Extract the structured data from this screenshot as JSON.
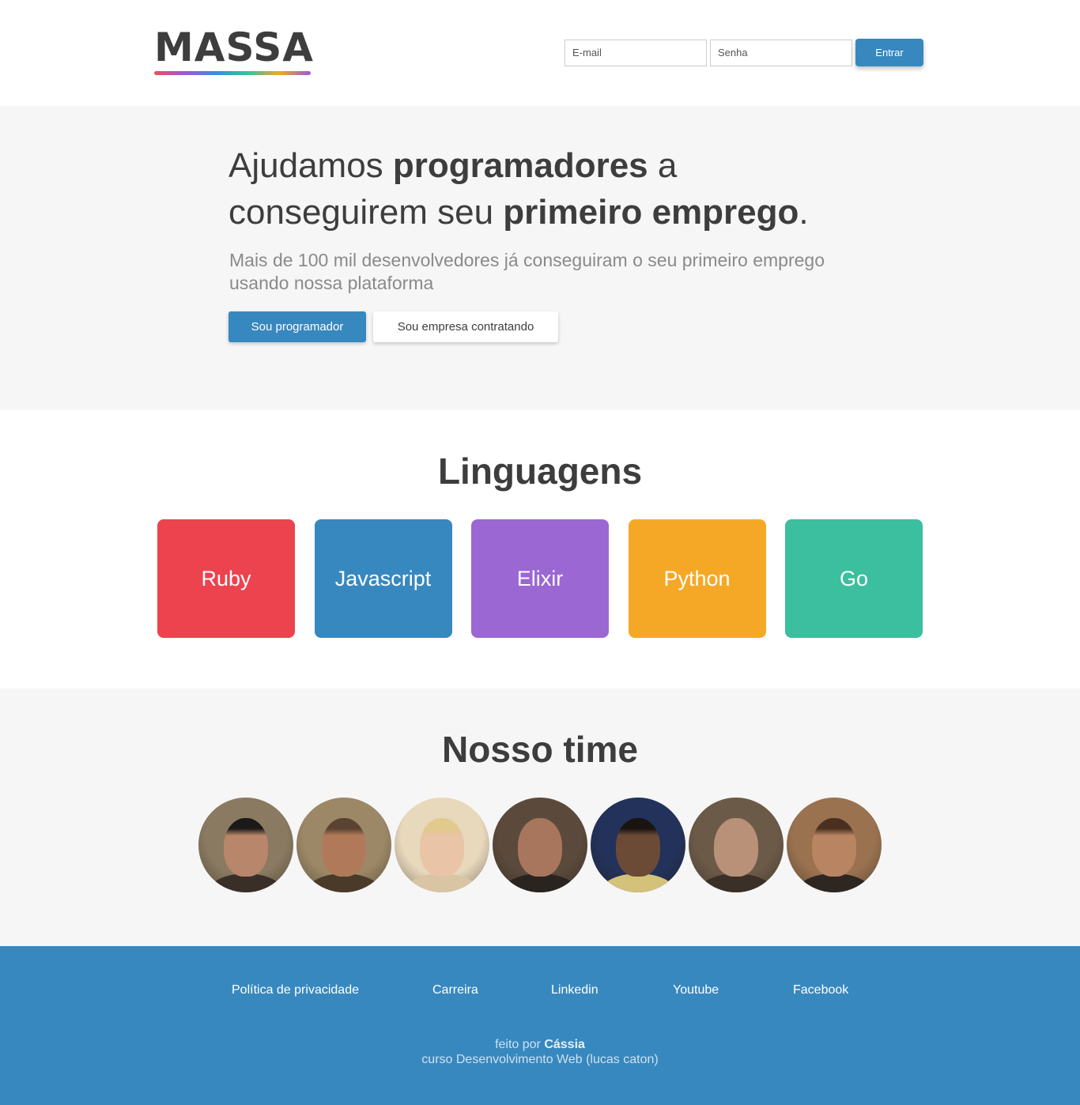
{
  "brand": {
    "logo": "MASSA",
    "logo_gradient": [
      "#ec4f5e",
      "#9b59d6",
      "#3a8fd9",
      "#3cc09f",
      "#f5a623",
      "#9b59d6"
    ]
  },
  "login": {
    "email_placeholder": "E-mail",
    "password_placeholder": "Senha",
    "submit_label": "Entrar"
  },
  "hero": {
    "title_parts": [
      "Ajudamos ",
      "programadores",
      " a conseguirem seu ",
      "primeiro emprego",
      "."
    ],
    "subtitle": "Mais de 100 mil desenvolvedores já conseguiram o seu primeiro emprego usando nossa plataforma",
    "primary_button": "Sou programador",
    "secondary_button": "Sou empresa contratando"
  },
  "languages": {
    "title": "Linguagens",
    "items": [
      {
        "label": "Ruby",
        "color": "#ec434e"
      },
      {
        "label": "Javascript",
        "color": "#3788bf"
      },
      {
        "label": "Elixir",
        "color": "#9b67d3"
      },
      {
        "label": "Python",
        "color": "#f5a826"
      },
      {
        "label": "Go",
        "color": "#3bbf9e"
      }
    ]
  },
  "team": {
    "title": "Nosso time",
    "members": [
      {
        "avatar_bg": "#8a7a62",
        "skin": "#b8866a",
        "cloth": "#3a2f28",
        "hair": "#1c1a18"
      },
      {
        "avatar_bg": "#9c8866",
        "skin": "#b07a5a",
        "cloth": "#4a3a2a",
        "hair": "#5a4330"
      },
      {
        "avatar_bg": "#e8d8bc",
        "skin": "#e9c4a6",
        "cloth": "#d9c4a4",
        "hair": "#e2c98c"
      },
      {
        "avatar_bg": "#5b4a3c",
        "skin": "#a7765c",
        "cloth": "#2a2420",
        "hair": "#a7765c"
      },
      {
        "avatar_bg": "#23325a",
        "skin": "#6b4a36",
        "cloth": "#d4c27a",
        "hair": "#1a1410"
      },
      {
        "avatar_bg": "#6c5a48",
        "skin": "#b99078",
        "cloth": "#3a3028",
        "hair": "#b99078"
      },
      {
        "avatar_bg": "#9a7250",
        "skin": "#b88462",
        "cloth": "#2e2620",
        "hair": "#4a3020"
      }
    ]
  },
  "footer": {
    "links": [
      "Política de privacidade",
      "Carreira",
      "Linkedin",
      "Youtube",
      "Facebook"
    ],
    "credit_prefix": "feito por ",
    "credit_name": "Cássia",
    "credit_course": "curso Desenvolvimento Web (lucas caton)"
  },
  "colors": {
    "primary": "#3788bf",
    "text": "#3d3d3d",
    "muted": "#8a8a8a",
    "section_bg": "#f6f6f6"
  }
}
